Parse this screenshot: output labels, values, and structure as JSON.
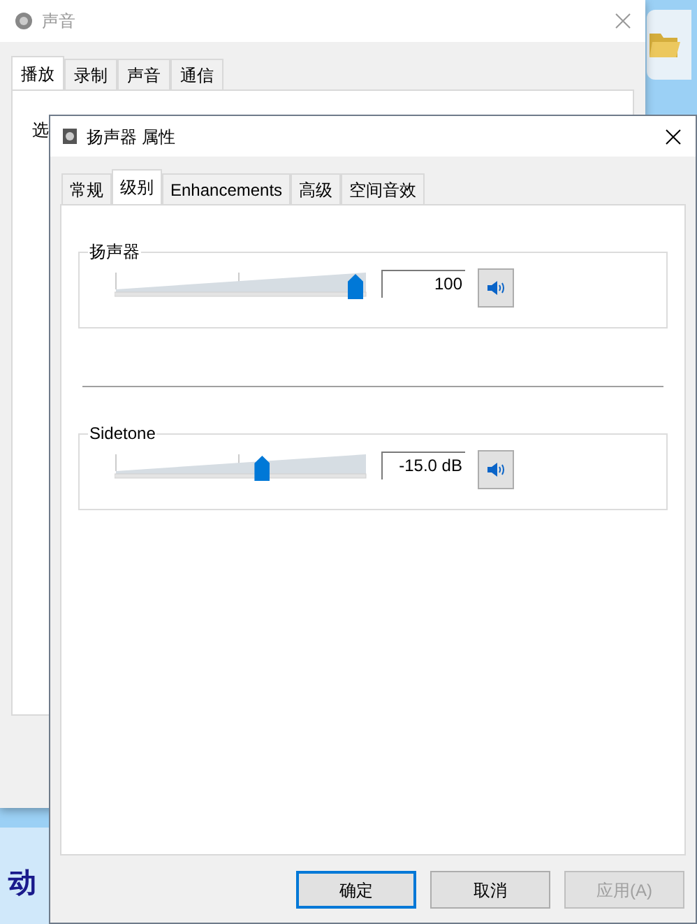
{
  "back_window": {
    "title": "声音",
    "tabs": [
      {
        "label": "播放",
        "selected": true
      },
      {
        "label": "录制",
        "selected": false
      },
      {
        "label": "声音",
        "selected": false
      },
      {
        "label": "通信",
        "selected": false
      }
    ],
    "panel_text": "选"
  },
  "desktop": {
    "banner_text": "动"
  },
  "dialog": {
    "title": "扬声器 属性",
    "tabs": [
      {
        "label": "常规",
        "selected": false
      },
      {
        "label": "级别",
        "selected": true
      },
      {
        "label": "Enhancements",
        "selected": false
      },
      {
        "label": "高级",
        "selected": false
      },
      {
        "label": "空间音效",
        "selected": false
      }
    ],
    "groups": [
      {
        "label": "扬声器",
        "level": 1.0,
        "reading": "100",
        "muted": false
      },
      {
        "label": "Sidetone",
        "level": 0.6,
        "reading": "-15.0 dB",
        "muted": false
      }
    ],
    "buttons": [
      {
        "label": "确定",
        "kind": "default",
        "disabled": false
      },
      {
        "label": "取消",
        "kind": "normal",
        "disabled": false
      },
      {
        "label": "应用(A)",
        "kind": "normal",
        "disabled": true
      }
    ]
  }
}
